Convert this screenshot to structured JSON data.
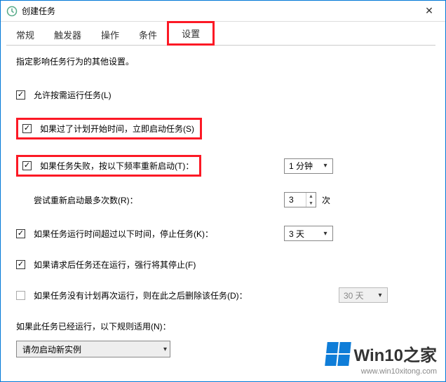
{
  "window": {
    "title": "创建任务",
    "close_label": "✕"
  },
  "tabs": {
    "general": "常规",
    "triggers": "触发器",
    "actions": "操作",
    "conditions": "条件",
    "settings": "设置"
  },
  "desc": "指定影响任务行为的其他设置。",
  "options": {
    "allow_on_demand": "允许按需运行任务(L)",
    "start_when_missed": "如果过了计划开始时间，立即启动任务(S)",
    "restart_on_fail": "如果任务失败，按以下频率重新启动(T)：",
    "restart_interval": "1 分钟",
    "retry_count_label": "尝试重新启动最多次数(R)：",
    "retry_count_value": "3",
    "retry_count_unit": "次",
    "stop_if_long": "如果任务运行时间超过以下时间，停止任务(K)：",
    "stop_after": "3 天",
    "force_stop": "如果请求后任务还在运行，强行将其停止(F)",
    "delete_if_unscheduled": "如果任务没有计划再次运行，则在此之后删除该任务(D)：",
    "delete_after": "30 天",
    "already_running_label": "如果此任务已经运行，以下规则适用(N)：",
    "rule_value": "请勿启动新实例"
  },
  "checked": {
    "allow_on_demand": true,
    "start_when_missed": true,
    "restart_on_fail": true,
    "stop_if_long": true,
    "force_stop": true,
    "delete_if_unscheduled": false
  },
  "watermark": {
    "text": "Win10之家",
    "url": "www.win10xitong.com"
  }
}
